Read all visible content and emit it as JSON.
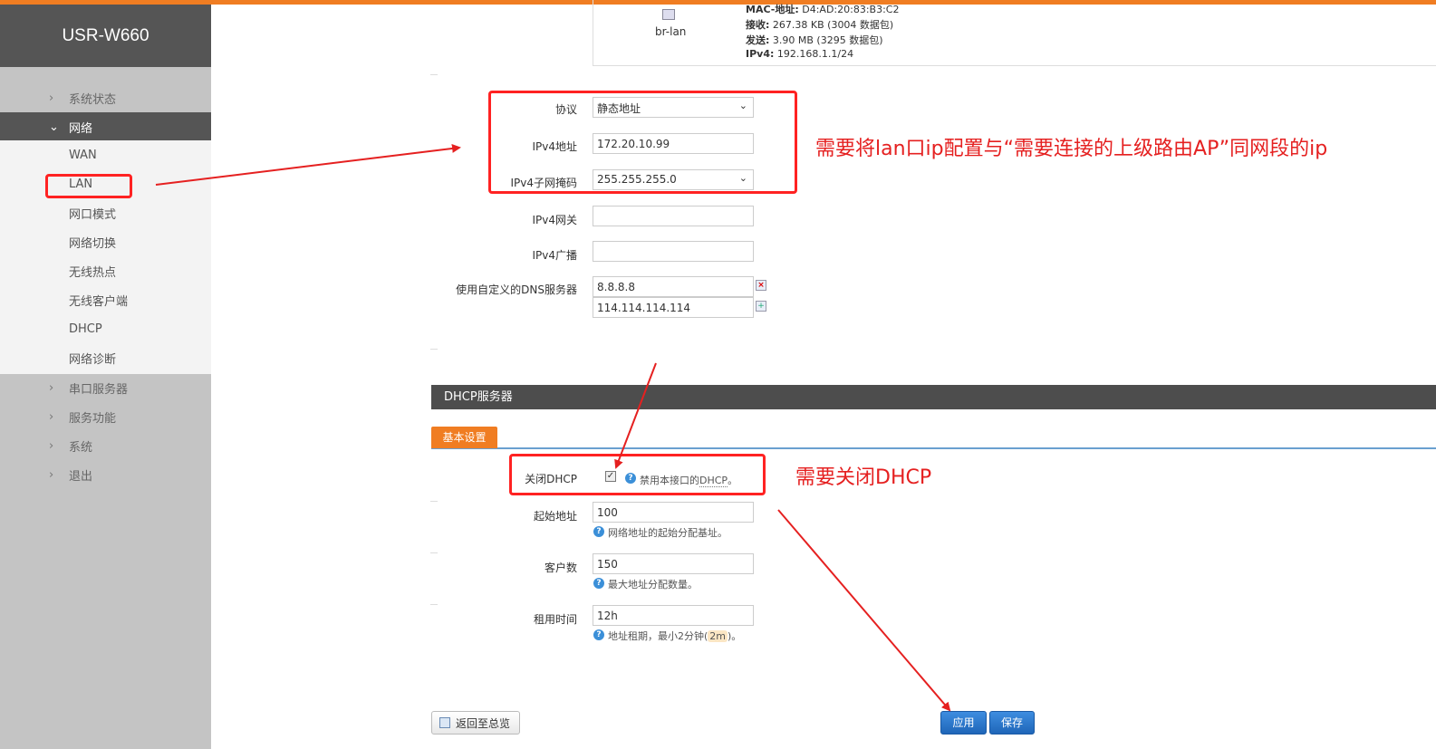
{
  "brand": "USR-W660",
  "sidebar": {
    "items": [
      {
        "label": "系统状态"
      },
      {
        "label": "网络"
      },
      {
        "label": "串口服务器"
      },
      {
        "label": "服务功能"
      },
      {
        "label": "系统"
      },
      {
        "label": "退出"
      }
    ],
    "sub_items": [
      {
        "label": "WAN"
      },
      {
        "label": "LAN"
      },
      {
        "label": "网口模式"
      },
      {
        "label": "网络切换"
      },
      {
        "label": "无线热点"
      },
      {
        "label": "无线客户端"
      },
      {
        "label": "DHCP"
      },
      {
        "label": "网络诊断"
      }
    ]
  },
  "interface": {
    "name": "br-lan",
    "mac_label": "MAC-地址:",
    "mac": "D4:AD:20:83:B3:C2",
    "rx_label": "接收:",
    "rx": "267.38 KB (3004 数据包)",
    "tx_label": "发送:",
    "tx": "3.90 MB (3295 数据包)",
    "ipv4_label": "IPv4:",
    "ipv4": "192.168.1.1/24"
  },
  "form": {
    "protocol_label": "协议",
    "protocol_value": "静态地址",
    "ipv4_addr_label": "IPv4地址",
    "ipv4_addr_value": "172.20.10.99",
    "netmask_label": "IPv4子网掩码",
    "netmask_value": "255.255.255.0",
    "gateway_label": "IPv4网关",
    "gateway_value": "",
    "broadcast_label": "IPv4广播",
    "broadcast_value": "",
    "dns_label": "使用自定义的DNS服务器",
    "dns": [
      "8.8.8.8",
      "114.114.114.114"
    ]
  },
  "dhcp": {
    "section_title": "DHCP服务器",
    "tab_basic": "基本设置",
    "disable_label": "关闭DHCP",
    "disable_checked": true,
    "disable_help_pre": "禁用本接口的",
    "disable_help_link": "DHCP",
    "disable_help_post": "。",
    "start_label": "起始地址",
    "start_value": "100",
    "start_help": "网络地址的起始分配基址。",
    "limit_label": "客户数",
    "limit_value": "150",
    "limit_help": "最大地址分配数量。",
    "lease_label": "租用时间",
    "lease_value": "12h",
    "lease_help_pre": "地址租期，最小2分钟(",
    "lease_help_pill": "2m",
    "lease_help_post": ")。"
  },
  "buttons": {
    "back": "返回至总览",
    "apply": "应用",
    "save": "保存"
  },
  "annotations": {
    "note_ip": "需要将lan口ip配置与“需要连接的上级路由AP”同网段的ip",
    "note_dhcp": "需要关闭DHCP",
    "color": "#e52020"
  },
  "colors": {
    "accent": "#f07d22",
    "sidebar_dark": "#555555",
    "button_blue": "#1f66b8"
  }
}
